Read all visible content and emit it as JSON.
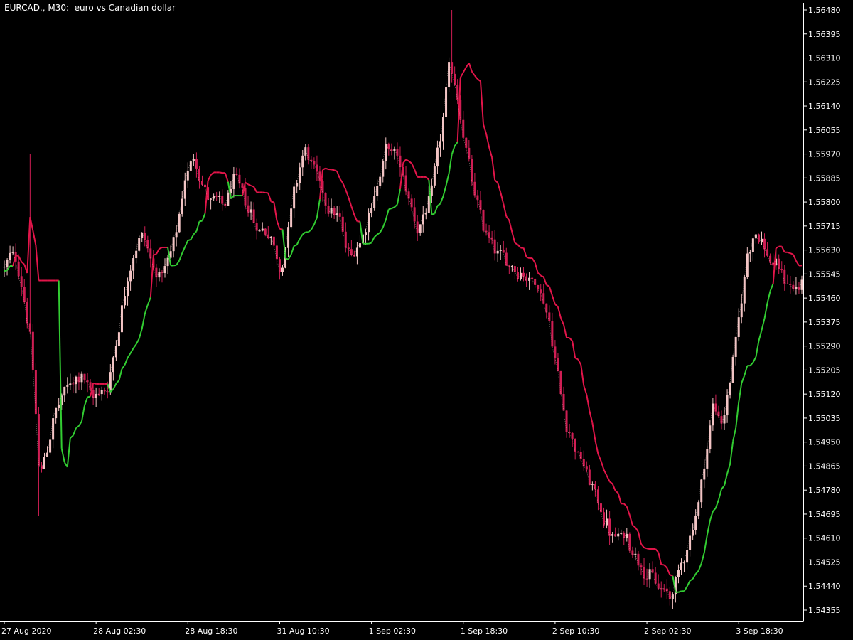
{
  "chart_title": "EURCAD., M30:  euro vs Canadian dollar",
  "colors": {
    "background": "#000000",
    "axis": "#ffffff",
    "bull_candle": "#f2c4c4",
    "bear_candle": "#d01e54",
    "band_upper": "#e3154a",
    "band_lower": "#32cd32",
    "signal_line": "#f0e0d8"
  },
  "chart_data": {
    "type": "candlestick",
    "title": "EURCAD., M30:  euro vs Canadian dollar",
    "ylim": [
      1.543,
      1.565
    ],
    "y_ticks": [
      "1.56480",
      "1.56395",
      "1.56310",
      "1.56225",
      "1.56140",
      "1.56055",
      "1.55970",
      "1.55885",
      "1.55800",
      "1.55715",
      "1.55630",
      "1.55545",
      "1.55460",
      "1.55375",
      "1.55290",
      "1.55205",
      "1.55120",
      "1.55035",
      "1.54950",
      "1.54865",
      "1.54780",
      "1.54695",
      "1.54610",
      "1.54525",
      "1.54440",
      "1.54355"
    ],
    "x_ticks": [
      {
        "label": "27 Aug 2020",
        "index": 0
      },
      {
        "label": "28 Aug 02:30",
        "index": 32
      },
      {
        "label": "28 Aug 18:30",
        "index": 64
      },
      {
        "label": "31 Aug 10:30",
        "index": 96
      },
      {
        "label": "1 Sep 02:30",
        "index": 128
      },
      {
        "label": "1 Sep 18:30",
        "index": 160
      },
      {
        "label": "2 Sep 10:30",
        "index": 192
      },
      {
        "label": "2 Sep 02:30",
        "index": 224
      },
      {
        "label": "3 Sep 18:30",
        "index": 256
      }
    ],
    "price_path": [
      [
        0,
        1.5557
      ],
      [
        3,
        1.5562
      ],
      [
        6,
        1.555
      ],
      [
        9,
        1.553
      ],
      [
        12,
        1.548
      ],
      [
        14,
        1.549
      ],
      [
        17,
        1.5505
      ],
      [
        22,
        1.5515
      ],
      [
        27,
        1.552
      ],
      [
        30,
        1.551
      ],
      [
        36,
        1.5515
      ],
      [
        40,
        1.554
      ],
      [
        44,
        1.556
      ],
      [
        48,
        1.557
      ],
      [
        52,
        1.5555
      ],
      [
        56,
        1.5555
      ],
      [
        60,
        1.557
      ],
      [
        63,
        1.559
      ],
      [
        66,
        1.5598
      ],
      [
        69,
        1.5585
      ],
      [
        72,
        1.558
      ],
      [
        76,
        1.5578
      ],
      [
        80,
        1.5588
      ],
      [
        84,
        1.558
      ],
      [
        88,
        1.557
      ],
      [
        92,
        1.557
      ],
      [
        96,
        1.5555
      ],
      [
        100,
        1.558
      ],
      [
        104,
        1.56
      ],
      [
        108,
        1.559
      ],
      [
        112,
        1.558
      ],
      [
        116,
        1.5575
      ],
      [
        120,
        1.556
      ],
      [
        124,
        1.5568
      ],
      [
        128,
        1.558
      ],
      [
        133,
        1.56
      ],
      [
        137,
        1.5595
      ],
      [
        141,
        1.558
      ],
      [
        144,
        1.557
      ],
      [
        148,
        1.558
      ],
      [
        152,
        1.5605
      ],
      [
        155,
        1.563
      ],
      [
        158,
        1.5615
      ],
      [
        161,
        1.5595
      ],
      [
        164,
        1.558
      ],
      [
        167,
        1.557
      ],
      [
        170,
        1.5565
      ],
      [
        173,
        1.556
      ],
      [
        176,
        1.5558
      ],
      [
        180,
        1.5555
      ],
      [
        184,
        1.5552
      ],
      [
        187,
        1.5548
      ],
      [
        190,
        1.5535
      ],
      [
        193,
        1.5515
      ],
      [
        196,
        1.55
      ],
      [
        200,
        1.549
      ],
      [
        204,
        1.548
      ],
      [
        208,
        1.547
      ],
      [
        212,
        1.546
      ],
      [
        216,
        1.5462
      ],
      [
        220,
        1.5455
      ],
      [
        224,
        1.5448
      ],
      [
        228,
        1.5443
      ],
      [
        232,
        1.544
      ],
      [
        235,
        1.545
      ],
      [
        238,
        1.546
      ],
      [
        241,
        1.547
      ],
      [
        244,
        1.549
      ],
      [
        247,
        1.551
      ],
      [
        250,
        1.55
      ],
      [
        253,
        1.552
      ],
      [
        256,
        1.554
      ],
      [
        259,
        1.5565
      ],
      [
        262,
        1.557
      ],
      [
        266,
        1.556
      ],
      [
        270,
        1.5555
      ],
      [
        274,
        1.555
      ],
      [
        278,
        1.555
      ]
    ]
  }
}
